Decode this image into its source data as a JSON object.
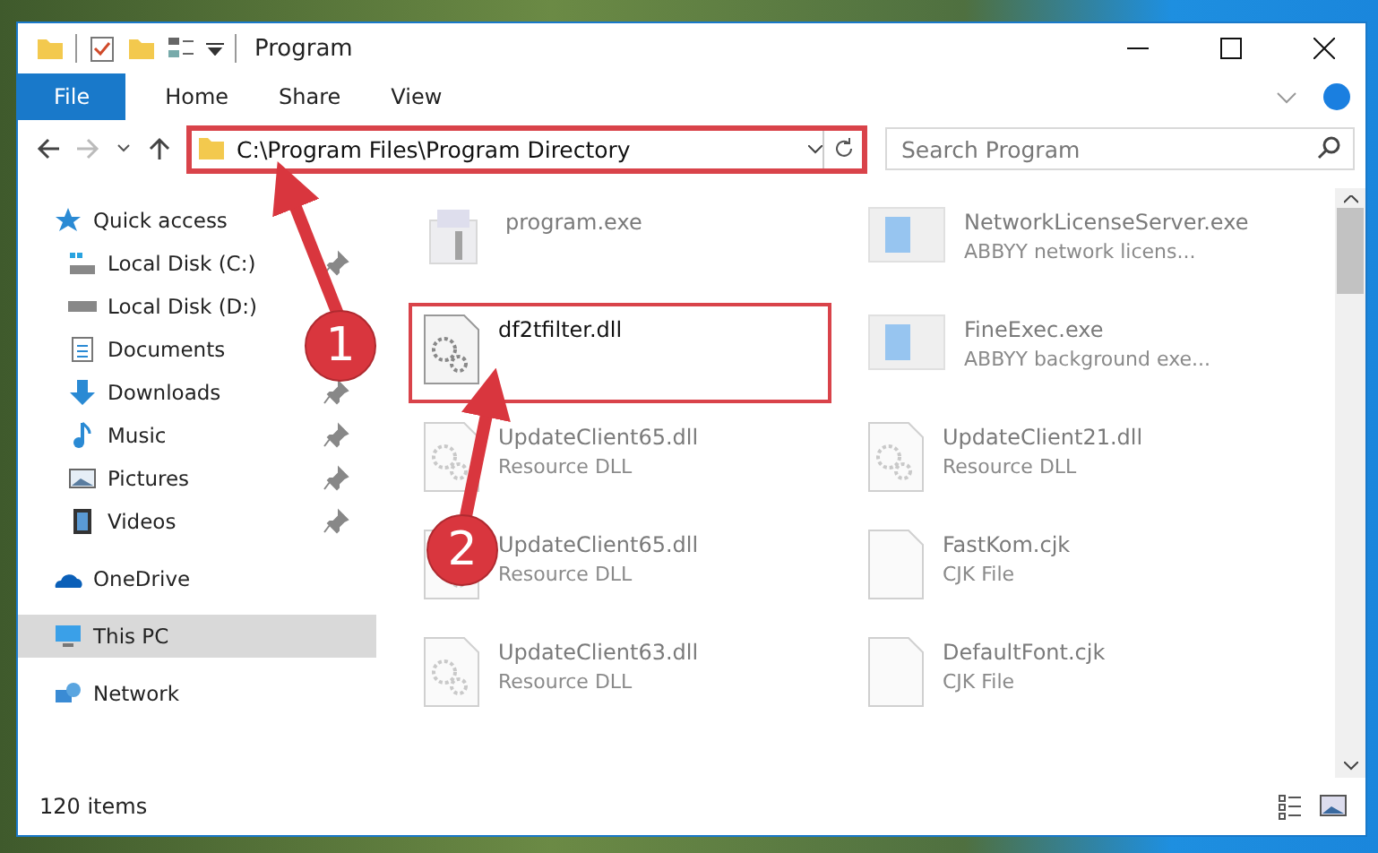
{
  "window": {
    "title": "Program"
  },
  "ribbon_tabs": [
    {
      "label": "File",
      "selected": true
    },
    {
      "label": "Home",
      "selected": false
    },
    {
      "label": "Share",
      "selected": false
    },
    {
      "label": "View",
      "selected": false
    }
  ],
  "address": {
    "path": "C:\\Program Files\\Program Directory",
    "highlighted": true
  },
  "search": {
    "placeholder": "Search Program"
  },
  "sidebar": [
    {
      "label": "Quick access",
      "kind": "quick",
      "selected": false,
      "children": [
        {
          "label": "Local Disk (C:)",
          "kind": "disk-c",
          "pinned": true,
          "selected": false
        },
        {
          "label": "Local Disk (D:)",
          "kind": "disk",
          "pinned": false,
          "selected": false
        },
        {
          "label": "Documents",
          "kind": "documents",
          "pinned": false,
          "selected": false
        },
        {
          "label": "Downloads",
          "kind": "downloads",
          "pinned": true,
          "selected": false
        },
        {
          "label": "Music",
          "kind": "music",
          "pinned": true,
          "selected": false
        },
        {
          "label": "Pictures",
          "kind": "pictures",
          "pinned": true,
          "selected": false
        },
        {
          "label": "Videos",
          "kind": "videos",
          "pinned": true,
          "selected": false
        }
      ]
    },
    {
      "label": "OneDrive",
      "kind": "onedrive",
      "selected": false
    },
    {
      "label": "This PC",
      "kind": "pc",
      "selected": true
    },
    {
      "label": "Network",
      "kind": "network",
      "selected": false
    }
  ],
  "files": [
    {
      "name": "program.exe",
      "kind": "setup",
      "dimmed": true,
      "highlighted": false
    },
    {
      "name": "NetworkLicenseServer.exe",
      "description": "ABBYY network licens...",
      "kind": "app",
      "dimmed": true,
      "highlighted": false
    },
    {
      "name": "df2tfilter.dll",
      "kind": "dll",
      "dimmed": false,
      "highlighted": true
    },
    {
      "name": "FineExec.exe",
      "description": "ABBYY background exe...",
      "kind": "app",
      "dimmed": true,
      "highlighted": false
    },
    {
      "name": "UpdateClient65.dll",
      "description": "Resource DLL",
      "kind": "dll",
      "dimmed": true,
      "highlighted": false
    },
    {
      "name": "UpdateClient21.dll",
      "description": "Resource DLL",
      "kind": "dll",
      "dimmed": true,
      "highlighted": false
    },
    {
      "name": "UpdateClient65.dll",
      "description": "Resource DLL",
      "kind": "dll",
      "dimmed": true,
      "highlighted": false
    },
    {
      "name": "FastKom.cjk",
      "description": "CJK File",
      "kind": "blank",
      "dimmed": true,
      "highlighted": false
    },
    {
      "name": "UpdateClient63.dll",
      "description": "Resource DLL",
      "kind": "dll",
      "dimmed": true,
      "highlighted": false
    },
    {
      "name": "DefaultFont.cjk",
      "description": "CJK File",
      "kind": "blank",
      "dimmed": true,
      "highlighted": false
    }
  ],
  "status_bar": {
    "count": "120 items"
  },
  "annotations": [
    {
      "number": "1"
    },
    {
      "number": "2"
    }
  ]
}
